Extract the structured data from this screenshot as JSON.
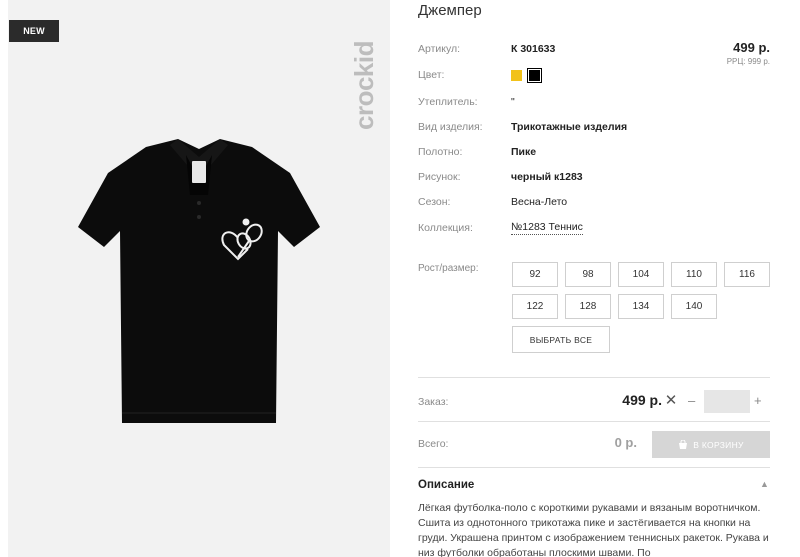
{
  "badge": "NEW",
  "brand": "crockid",
  "product": {
    "title": "Джемпер",
    "price": "499 р.",
    "rrp": "РРЦ: 999 р."
  },
  "attributes": {
    "article_label": "Артикул:",
    "article_value": "К 301633",
    "color_label": "Цвет:",
    "colors": [
      "#f2c21a",
      "#000000"
    ],
    "insulation_label": "Утеплитель:",
    "insulation_value": "\"",
    "type_label": "Вид изделия:",
    "type_value": "Трикотажные изделия",
    "fabric_label": "Полотно:",
    "fabric_value": "Пике",
    "pattern_label": "Рисунок:",
    "pattern_value": "черный к1283",
    "season_label": "Сезон:",
    "season_value": "Весна-Лето",
    "collection_label": "Коллекция:",
    "collection_value": "№1283 Теннис"
  },
  "sizes": {
    "label": "Рост/размер:",
    "items": [
      "92",
      "98",
      "104",
      "110",
      "116",
      "122",
      "128",
      "134",
      "140"
    ],
    "select_all": "ВЫБРАТЬ ВСЕ"
  },
  "order": {
    "label": "Заказ:",
    "price": "499 р.",
    "qty": ""
  },
  "total": {
    "label": "Всего:",
    "value": "0 р.",
    "cart_button": "В КОРЗИНУ"
  },
  "description": {
    "title": "Описание",
    "text": "Лёгкая футболка-поло с короткими рукавами и вязаным воротничком. Сшита из однотонного трикотажа пике и застёгивается на кнопки на груди. Украшена принтом с изображением теннисных ракеток. Рукава и низ футболки обработаны плоскими швами. По"
  }
}
